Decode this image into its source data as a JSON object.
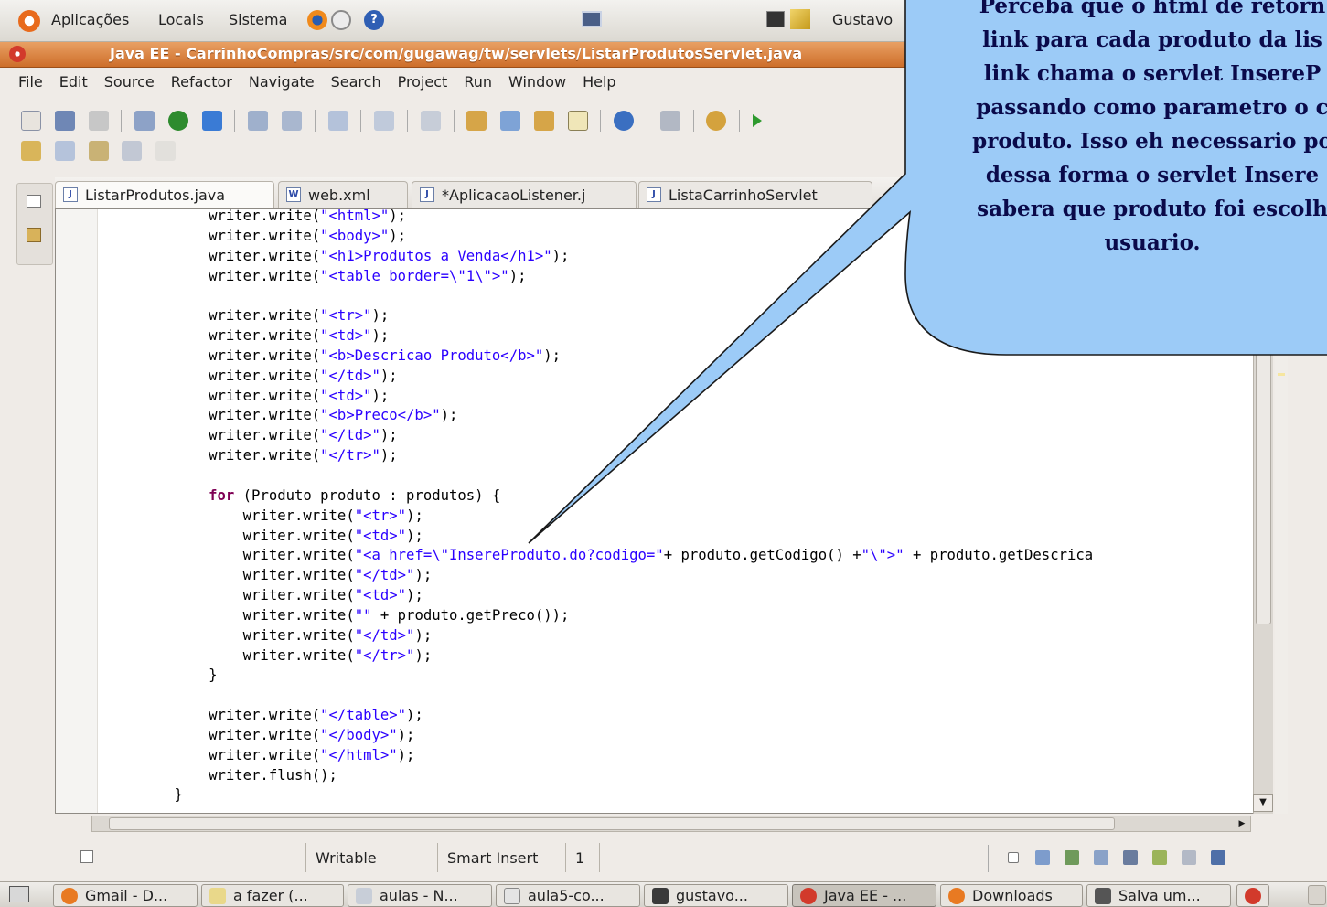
{
  "panel": {
    "menus": [
      "Aplicações",
      "Locais",
      "Sistema"
    ],
    "user": "Gustavo"
  },
  "window": {
    "title": "Java EE - CarrinhoCompras/src/com/gugawag/tw/servlets/ListarProdutosServlet.java"
  },
  "menubar": [
    "File",
    "Edit",
    "Source",
    "Refactor",
    "Navigate",
    "Search",
    "Project",
    "Run",
    "Window",
    "Help"
  ],
  "tabs": [
    "ListarProdutos.java",
    "web.xml",
    "*AplicacaoListener.j",
    "ListaCarrinhoServlet"
  ],
  "code": [
    {
      "parts": [
        [
          "",
          "        writer.write("
        ],
        [
          "str",
          "\"<html>\""
        ],
        [
          "",
          ");"
        ]
      ]
    },
    {
      "parts": [
        [
          "",
          "        writer.write("
        ],
        [
          "str",
          "\"<body>\""
        ],
        [
          "",
          ");"
        ]
      ]
    },
    {
      "parts": [
        [
          "",
          "        writer.write("
        ],
        [
          "str",
          "\"<h1>Produtos a Venda</h1>\""
        ],
        [
          "",
          ");"
        ]
      ]
    },
    {
      "parts": [
        [
          "",
          "        writer.write("
        ],
        [
          "str",
          "\"<table border=\\\"1\\\">\""
        ],
        [
          "",
          ");"
        ]
      ]
    },
    {
      "parts": [
        [
          "",
          ""
        ]
      ]
    },
    {
      "parts": [
        [
          "",
          "        writer.write("
        ],
        [
          "str",
          "\"<tr>\""
        ],
        [
          "",
          ");"
        ]
      ]
    },
    {
      "parts": [
        [
          "",
          "        writer.write("
        ],
        [
          "str",
          "\"<td>\""
        ],
        [
          "",
          ");"
        ]
      ]
    },
    {
      "parts": [
        [
          "",
          "        writer.write("
        ],
        [
          "str",
          "\"<b>Descricao Produto</b>\""
        ],
        [
          "",
          ");"
        ]
      ]
    },
    {
      "parts": [
        [
          "",
          "        writer.write("
        ],
        [
          "str",
          "\"</td>\""
        ],
        [
          "",
          ");"
        ]
      ]
    },
    {
      "parts": [
        [
          "",
          "        writer.write("
        ],
        [
          "str",
          "\"<td>\""
        ],
        [
          "",
          ");"
        ]
      ]
    },
    {
      "parts": [
        [
          "",
          "        writer.write("
        ],
        [
          "str",
          "\"<b>Preco</b>\""
        ],
        [
          "",
          ");"
        ]
      ]
    },
    {
      "parts": [
        [
          "",
          "        writer.write("
        ],
        [
          "str",
          "\"</td>\""
        ],
        [
          "",
          ");"
        ]
      ]
    },
    {
      "parts": [
        [
          "",
          "        writer.write("
        ],
        [
          "str",
          "\"</tr>\""
        ],
        [
          "",
          ");"
        ]
      ]
    },
    {
      "parts": [
        [
          "",
          ""
        ]
      ]
    },
    {
      "parts": [
        [
          "",
          "        "
        ],
        [
          "kw",
          "for"
        ],
        [
          "",
          " (Produto produto : produtos) {"
        ]
      ]
    },
    {
      "parts": [
        [
          "",
          "            writer.write("
        ],
        [
          "str",
          "\"<tr>\""
        ],
        [
          "",
          ");"
        ]
      ]
    },
    {
      "parts": [
        [
          "",
          "            writer.write("
        ],
        [
          "str",
          "\"<td>\""
        ],
        [
          "",
          ");"
        ]
      ]
    },
    {
      "parts": [
        [
          "",
          "            writer.write("
        ],
        [
          "str",
          "\"<a href=\\\"InsereProduto.do?codigo=\""
        ],
        [
          "",
          "+ produto.getCodigo() +"
        ],
        [
          "str",
          "\"\\\">\""
        ],
        [
          "",
          " + produto.getDescrica"
        ]
      ]
    },
    {
      "parts": [
        [
          "",
          "            writer.write("
        ],
        [
          "str",
          "\"</td>\""
        ],
        [
          "",
          ");"
        ]
      ]
    },
    {
      "parts": [
        [
          "",
          "            writer.write("
        ],
        [
          "str",
          "\"<td>\""
        ],
        [
          "",
          ");"
        ]
      ]
    },
    {
      "parts": [
        [
          "",
          "            writer.write("
        ],
        [
          "str",
          "\"\""
        ],
        [
          "",
          " + produto.getPreco());"
        ]
      ]
    },
    {
      "parts": [
        [
          "",
          "            writer.write("
        ],
        [
          "str",
          "\"</td>\""
        ],
        [
          "",
          ");"
        ]
      ]
    },
    {
      "parts": [
        [
          "",
          "            writer.write("
        ],
        [
          "str",
          "\"</tr>\""
        ],
        [
          "",
          ");"
        ]
      ]
    },
    {
      "parts": [
        [
          "",
          "        }"
        ]
      ]
    },
    {
      "parts": [
        [
          "",
          ""
        ]
      ]
    },
    {
      "parts": [
        [
          "",
          "        writer.write("
        ],
        [
          "str",
          "\"</table>\""
        ],
        [
          "",
          ");"
        ]
      ]
    },
    {
      "parts": [
        [
          "",
          "        writer.write("
        ],
        [
          "str",
          "\"</body>\""
        ],
        [
          "",
          ");"
        ]
      ]
    },
    {
      "parts": [
        [
          "",
          "        writer.write("
        ],
        [
          "str",
          "\"</html>\""
        ],
        [
          "",
          ");"
        ]
      ]
    },
    {
      "parts": [
        [
          "",
          "        writer.flush();"
        ]
      ]
    },
    {
      "parts": [
        [
          "",
          "    }"
        ]
      ]
    }
  ],
  "status": {
    "writable": "Writable",
    "insert_mode": "Smart Insert",
    "position": "1"
  },
  "taskbar": [
    "Gmail - D...",
    "a fazer (...",
    "aulas - N...",
    "aula5-co...",
    "gustavo...",
    "Java EE - ...",
    "Downloads",
    "Salva um..."
  ],
  "callout": {
    "lines": [
      "Perceba que o html de retorn",
      "link para cada produto da lis",
      "link chama o servlet InsereP",
      "passando como parametro o c",
      "produto. Isso eh necessario po",
      "dessa forma o servlet Insere",
      "sabera que produto foi escolh",
      "usuario."
    ]
  },
  "colors": {
    "desktop": "#2c74c8",
    "callout_fill": "#9ccbf7",
    "keyword": "#7f0055",
    "string": "#2a00ff"
  }
}
